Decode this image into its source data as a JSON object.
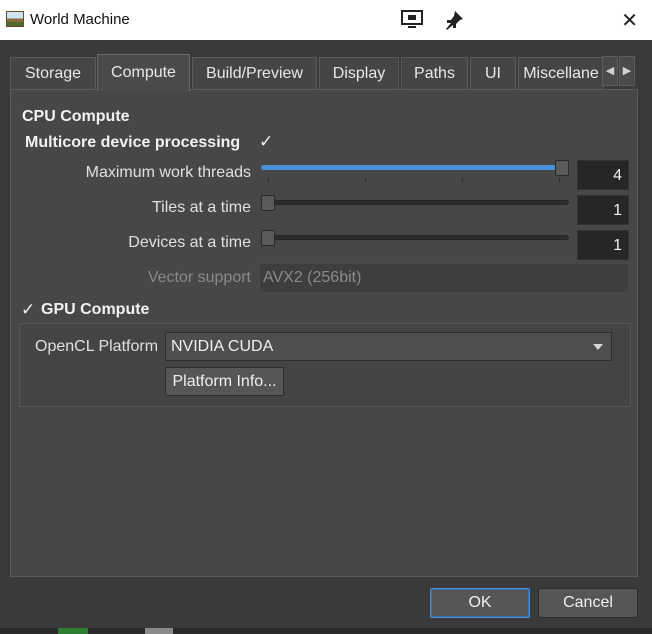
{
  "window": {
    "title": "World Machine",
    "icons": {
      "app": "world-machine-app-icon",
      "screen": "monitor-icon",
      "pin": "pin-icon",
      "close": "close-icon"
    },
    "close_glyph": "✕"
  },
  "tabs": [
    {
      "label": "Storage",
      "active": false
    },
    {
      "label": "Compute",
      "active": true
    },
    {
      "label": "Build/Preview",
      "active": false
    },
    {
      "label": "Display",
      "active": false
    },
    {
      "label": "Paths",
      "active": false
    },
    {
      "label": "UI",
      "active": false
    },
    {
      "label": "Miscellane",
      "active": false
    }
  ],
  "tab_scroll": {
    "left": "◀",
    "right": "▶"
  },
  "cpu": {
    "section_title": "CPU Compute",
    "multicore_label": "Multicore device processing",
    "multicore_checked": true,
    "check_glyph": "✓",
    "max_threads": {
      "label": "Maximum work threads",
      "value": "4",
      "slider_fraction": 1.0
    },
    "tiles": {
      "label": "Tiles at a time",
      "value": "1",
      "slider_fraction": 0.0
    },
    "devices": {
      "label": "Devices at a time",
      "value": "1",
      "slider_fraction": 0.0
    },
    "vector": {
      "label": "Vector support",
      "value": "AVX2 (256bit)",
      "disabled": true
    }
  },
  "gpu": {
    "section_title": "GPU Compute",
    "enabled": true,
    "check_glyph": "✓",
    "platform_label": "OpenCL Platform",
    "platform_value": "NVIDIA CUDA",
    "platform_info_button": "Platform Info..."
  },
  "footer": {
    "ok_label": "OK",
    "cancel_label": "Cancel"
  },
  "colors": {
    "accent": "#4a90d9",
    "background": "#474747",
    "titlebar": "#ffffff"
  }
}
